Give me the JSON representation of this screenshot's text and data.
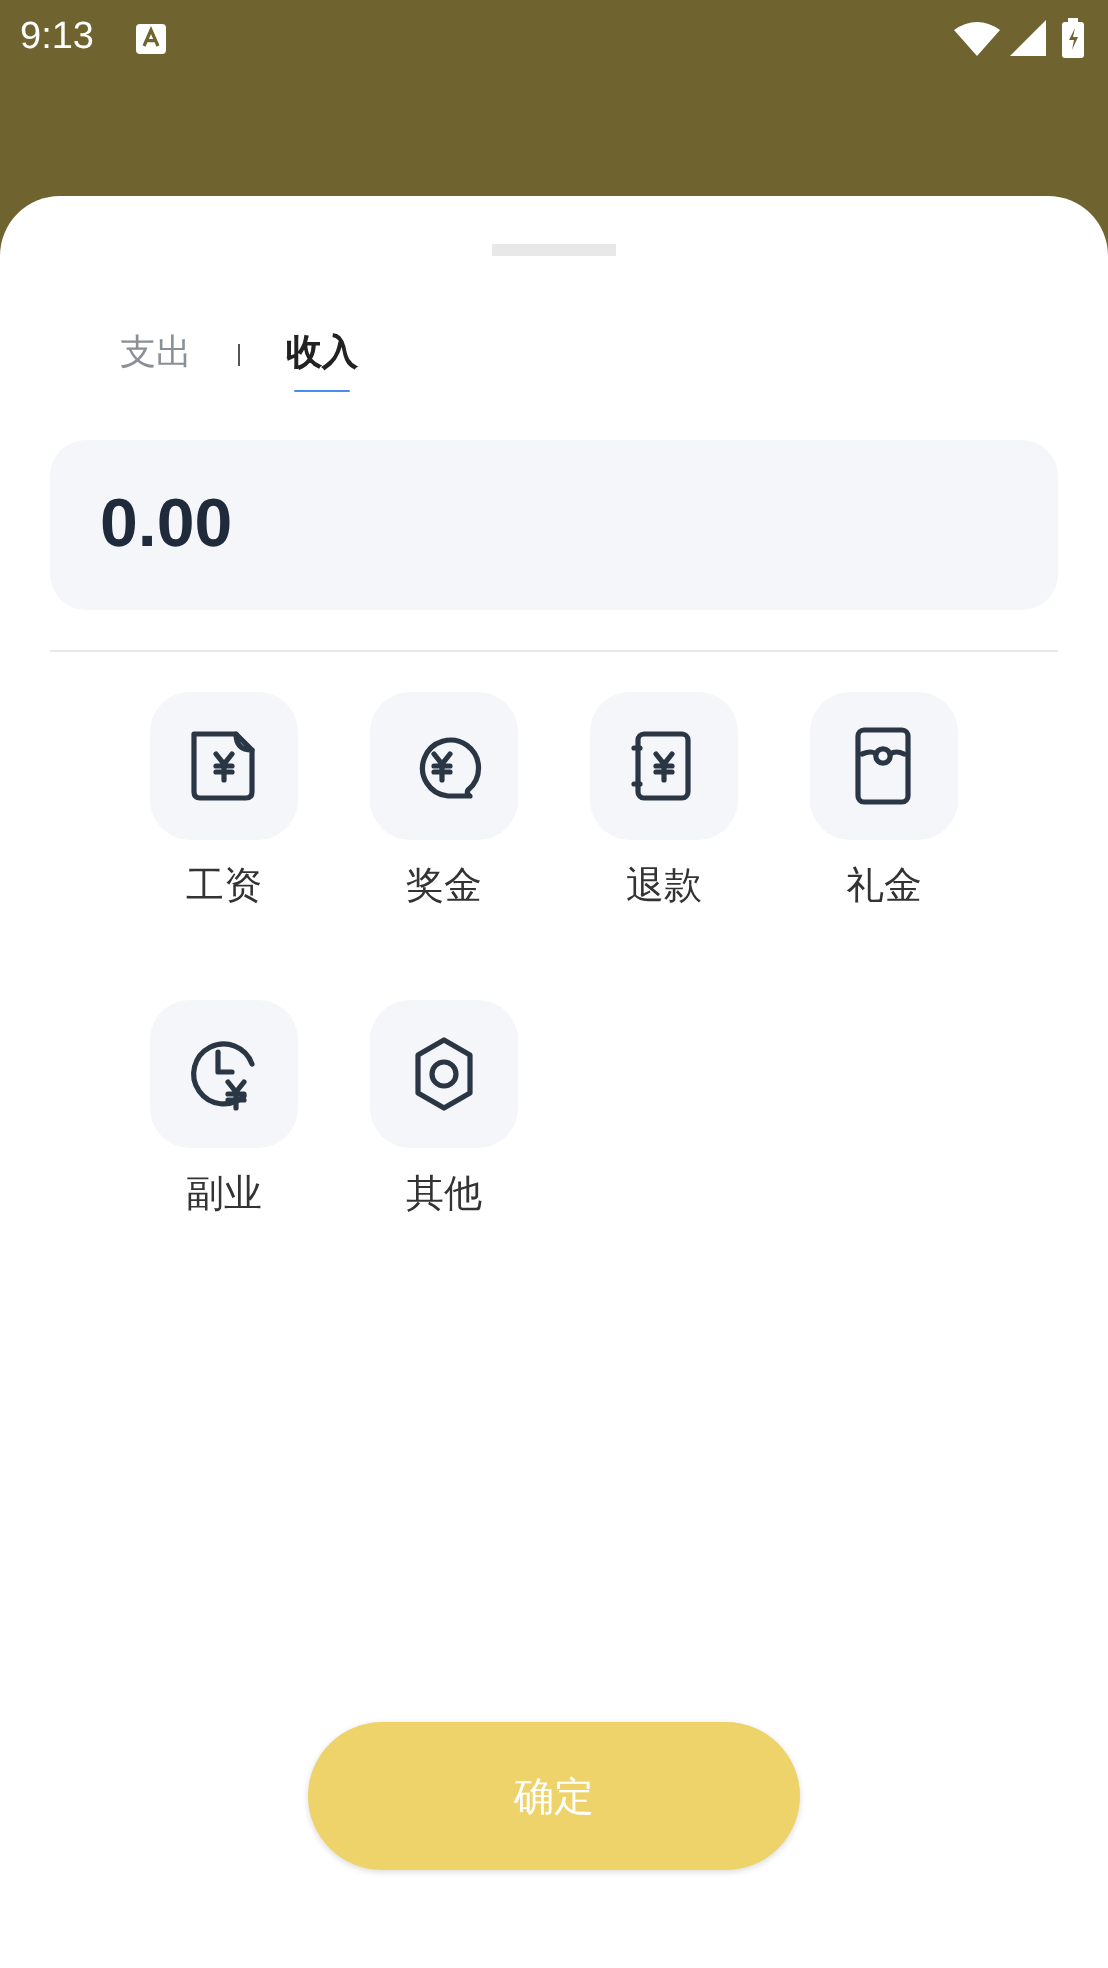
{
  "status_bar": {
    "time": "9:13"
  },
  "tabs": [
    {
      "label": "支出",
      "selected": false
    },
    {
      "label": "收入",
      "selected": true
    }
  ],
  "amount": {
    "value": "0.00"
  },
  "categories": [
    {
      "label": "工资",
      "kind": "salary"
    },
    {
      "label": "奖金",
      "kind": "bonus"
    },
    {
      "label": "退款",
      "kind": "refund"
    },
    {
      "label": "礼金",
      "kind": "gift"
    },
    {
      "label": "副业",
      "kind": "sideline"
    },
    {
      "label": "其他",
      "kind": "other"
    }
  ],
  "confirm_button": {
    "label": "确定"
  }
}
